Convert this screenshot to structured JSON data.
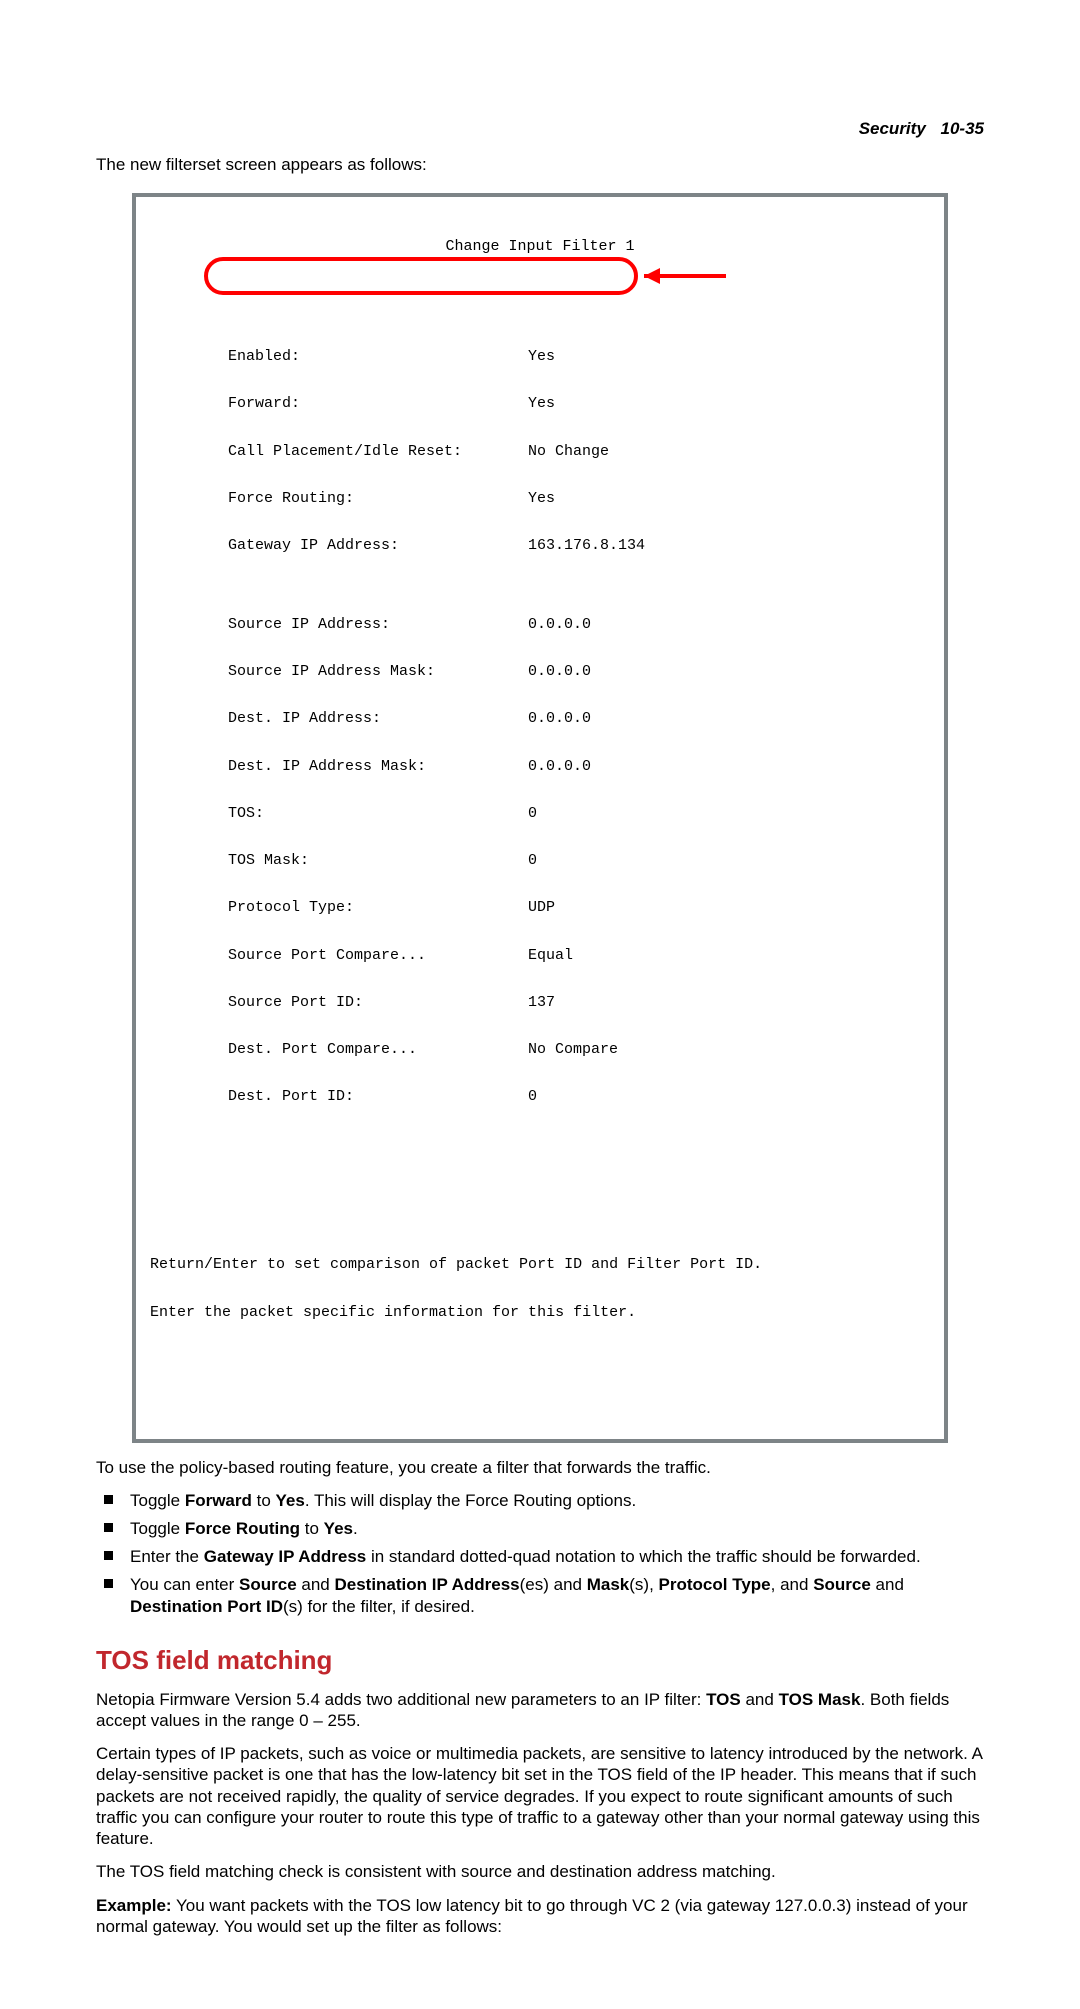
{
  "header": {
    "section": "Security",
    "pageno": "10-35"
  },
  "intro": "The new filterset screen appears as follows:",
  "terminal": {
    "title": "Change Input Filter 1",
    "rows": [
      {
        "label": "Enabled:",
        "value": "Yes"
      },
      {
        "label": "Forward:",
        "value": "Yes"
      },
      {
        "label": "Call Placement/Idle Reset:",
        "value": "No Change"
      },
      {
        "label": "Force Routing:",
        "value": "Yes"
      },
      {
        "label": "Gateway IP Address:",
        "value": "163.176.8.134"
      },
      {
        "label": "",
        "value": ""
      },
      {
        "label": "Source IP Address:",
        "value": "0.0.0.0"
      },
      {
        "label": "Source IP Address Mask:",
        "value": "0.0.0.0"
      },
      {
        "label": "Dest. IP Address:",
        "value": "0.0.0.0"
      },
      {
        "label": "Dest. IP Address Mask:",
        "value": "0.0.0.0"
      },
      {
        "label": "TOS:",
        "value": "0"
      },
      {
        "label": "TOS Mask:",
        "value": "0"
      },
      {
        "label": "Protocol Type:",
        "value": "UDP"
      },
      {
        "label": "Source Port Compare...",
        "value": "Equal"
      },
      {
        "label": "Source Port ID:",
        "value": "137"
      },
      {
        "label": "Dest. Port Compare...",
        "value": "No Compare"
      },
      {
        "label": "Dest. Port ID:",
        "value": "0"
      }
    ],
    "footer1": "Return/Enter to set comparison of packet Port ID and Filter Port ID.",
    "footer2": "Enter the packet specific information for this filter."
  },
  "after_box": "To use the policy-based routing feature, you create a filter that forwards the traffic.",
  "bullets": {
    "b1a": "Toggle ",
    "b1b": "Forward",
    "b1c": " to ",
    "b1d": "Yes",
    "b1e": ". This will display the Force Routing options.",
    "b2a": "Toggle ",
    "b2b": "Force Routing",
    "b2c": " to ",
    "b2d": "Yes",
    "b2e": ".",
    "b3a": "Enter the ",
    "b3b": "Gateway IP Address",
    "b3c": " in standard dotted-quad notation to which the traffic should be forwarded.",
    "b4a": "You can enter ",
    "b4b": "Source",
    "b4c": " and ",
    "b4d": "Destination IP Address",
    "b4e": "(es) and ",
    "b4f": "Mask",
    "b4g": "(s), ",
    "b4h": "Protocol Type",
    "b4i": ", and ",
    "b4j": "Source",
    "b4k": " and ",
    "b4l": "Destination Port ID",
    "b4m": "(s) for the filter, if desired."
  },
  "section_heading": "TOS field matching",
  "p1a": "Netopia Firmware Version 5.4 adds two additional new parameters to an IP filter: ",
  "p1b": "TOS",
  "p1c": " and ",
  "p1d": "TOS Mask",
  "p1e": ". Both fields accept values in the range 0 – 255.",
  "p2": "Certain types of IP packets, such as voice or multimedia packets, are sensitive to latency introduced by the network. A delay-sensitive packet is one that has the low-latency bit set in the TOS field of the IP header. This means that if such packets are not received rapidly, the quality of service degrades. If you expect to route significant amounts of such traffic you can configure your router to route this type of traffic to a gateway other than your normal gateway using this feature.",
  "p3": "The TOS field matching check is consistent with source and destination address matching.",
  "p4a": "Example:",
  "p4b": "  You want packets with the TOS low latency bit to go through VC 2 (via gateway 127.0.0.3) instead of your normal gateway. You would set up the filter as follows:"
}
